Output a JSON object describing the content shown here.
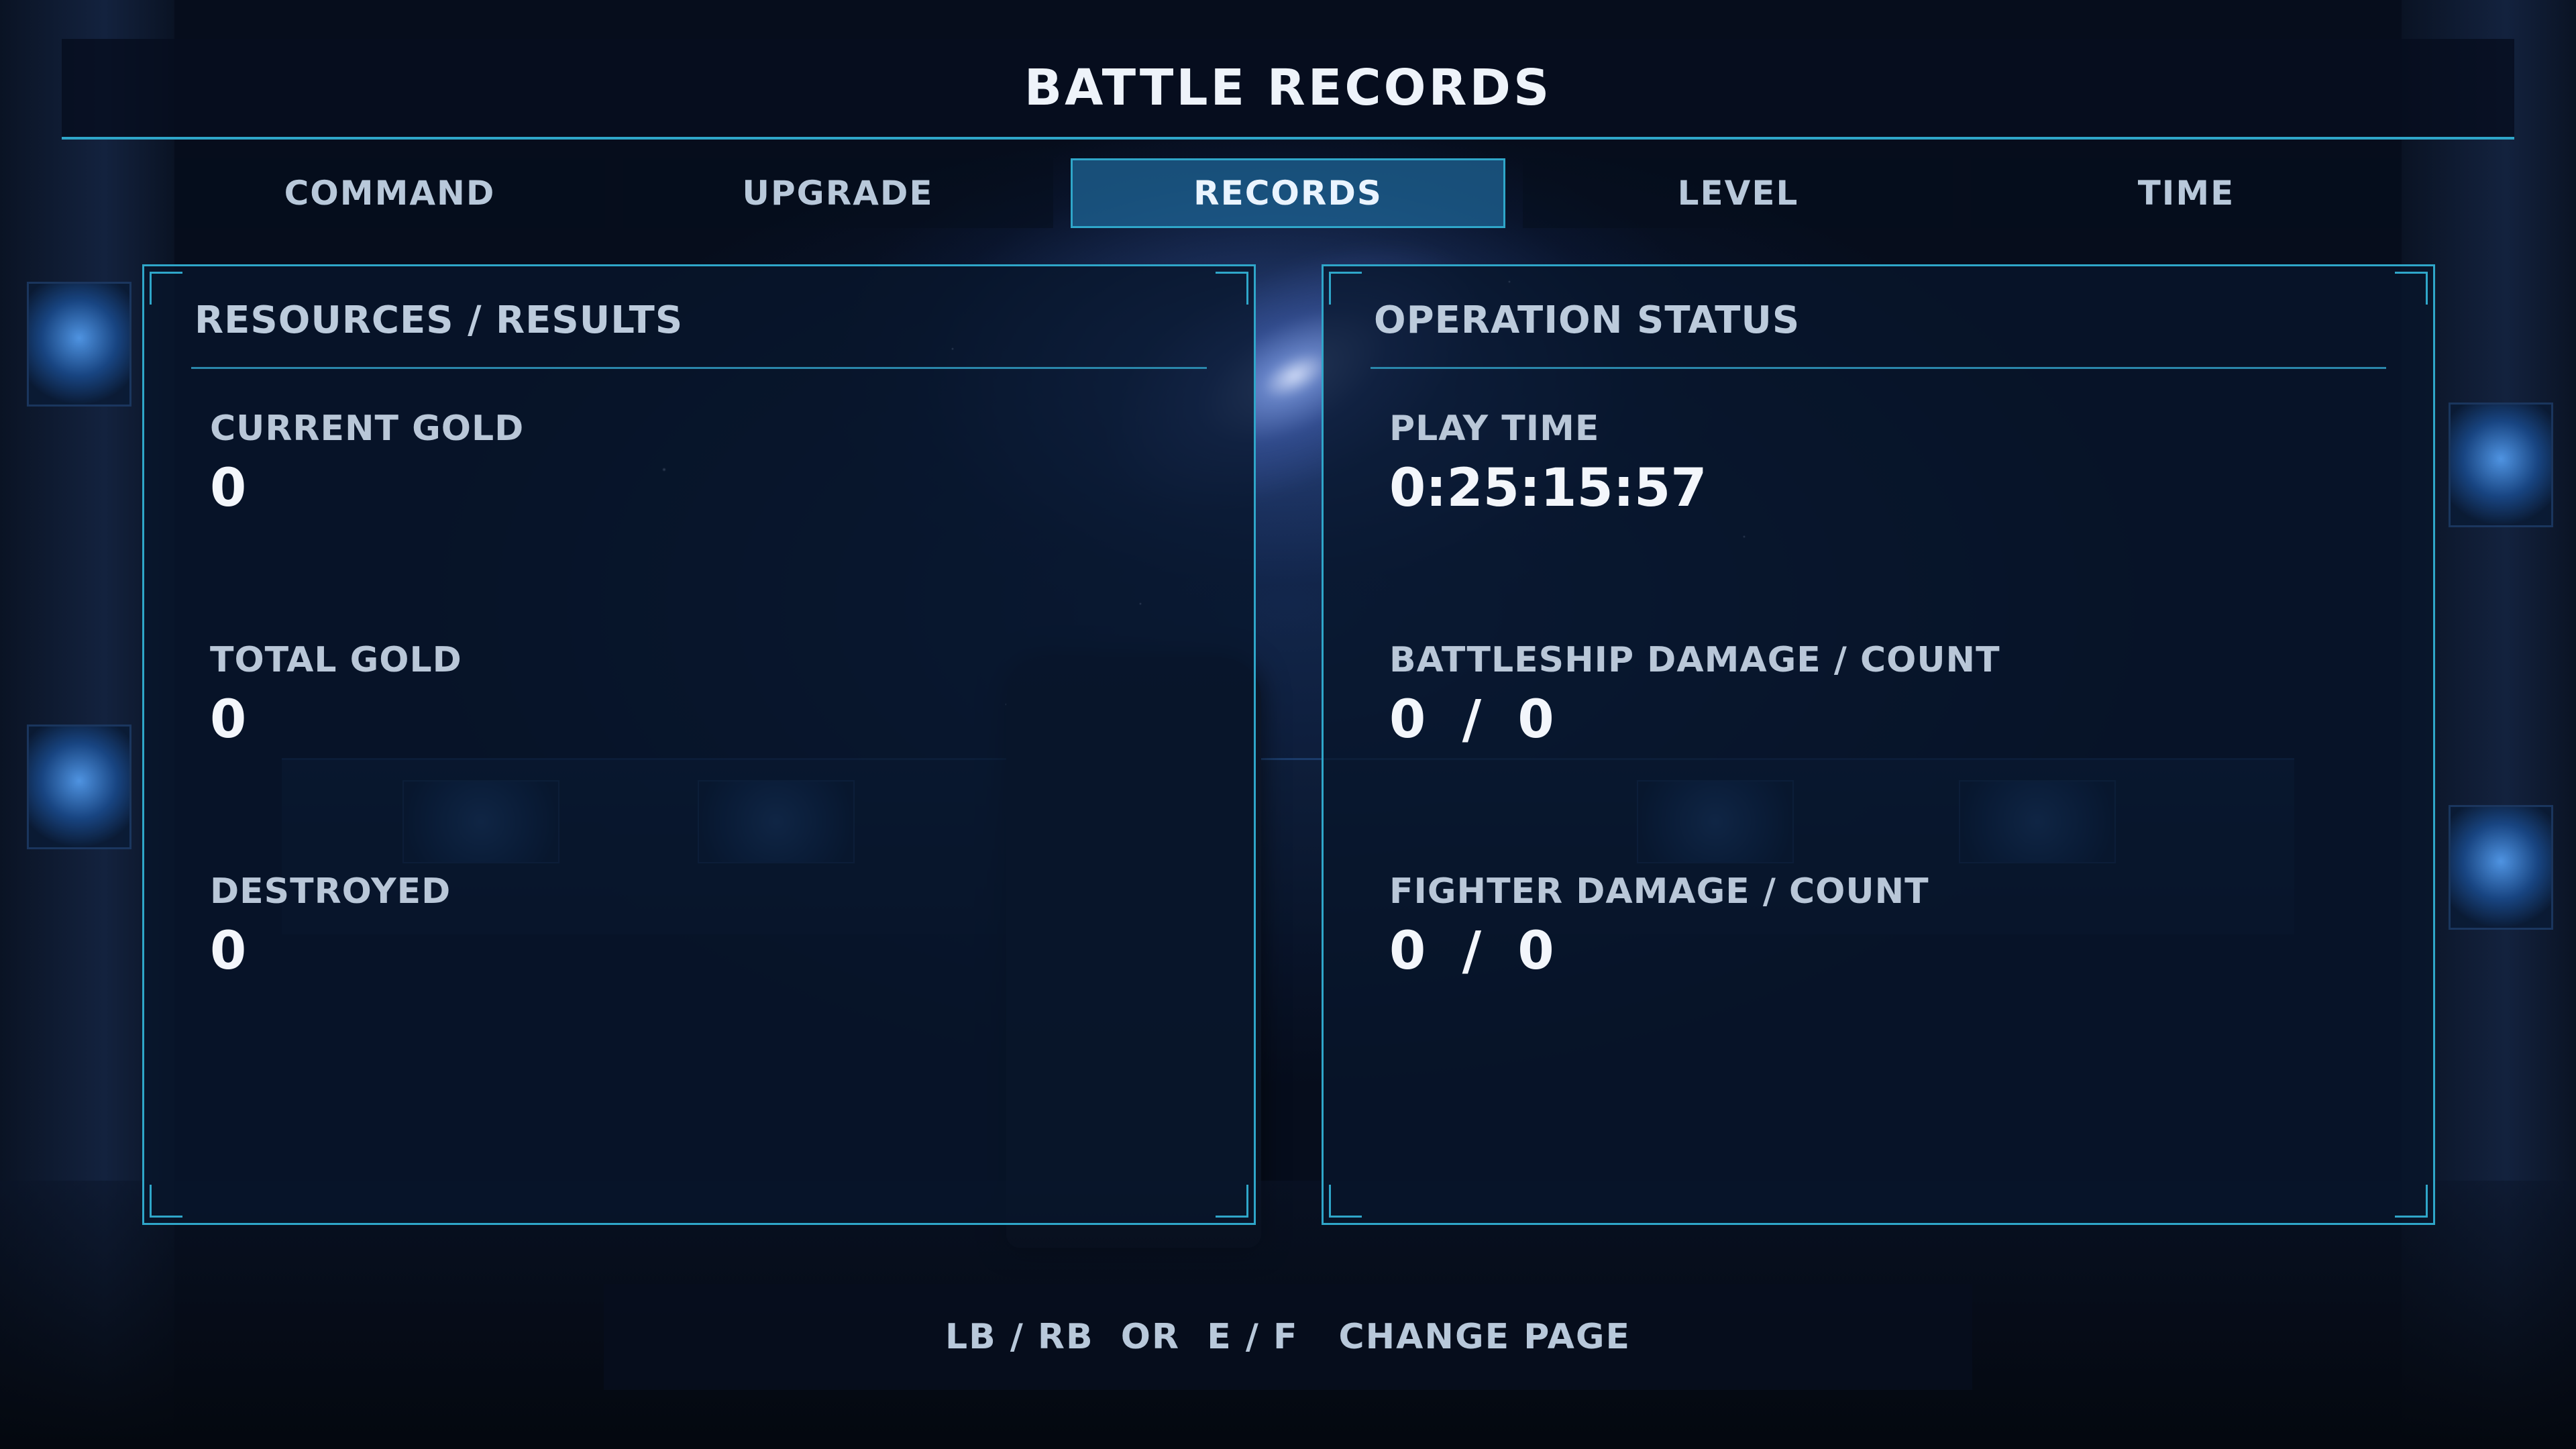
{
  "header": {
    "title": "BATTLE RECORDS"
  },
  "tabs": [
    {
      "label": "COMMAND",
      "active": false
    },
    {
      "label": "UPGRADE",
      "active": false
    },
    {
      "label": "RECORDS",
      "active": true
    },
    {
      "label": "LEVEL",
      "active": false
    },
    {
      "label": "TIME",
      "active": false
    }
  ],
  "left_panel": {
    "title": "RESOURCES / RESULTS",
    "stats": [
      {
        "label": "CURRENT GOLD",
        "value": "0"
      },
      {
        "label": "TOTAL GOLD",
        "value": "0"
      },
      {
        "label": "DESTROYED",
        "value": "0"
      }
    ]
  },
  "right_panel": {
    "title": "OPERATION STATUS",
    "stats": [
      {
        "label": "PLAY TIME",
        "value": "0:25:15:57"
      },
      {
        "label": "BATTLESHIP DAMAGE / COUNT",
        "value": "0  /  0"
      },
      {
        "label": "FIGHTER DAMAGE / COUNT",
        "value": "0  /  0"
      }
    ]
  },
  "footer": {
    "controls": "LB / RB  OR  E / F",
    "action": "CHANGE PAGE"
  },
  "colors": {
    "accent": "#2fa6c9",
    "active_tab_bg": "#1e6496",
    "text_light": "#eef3fa",
    "text_muted": "#b9c7d8"
  }
}
